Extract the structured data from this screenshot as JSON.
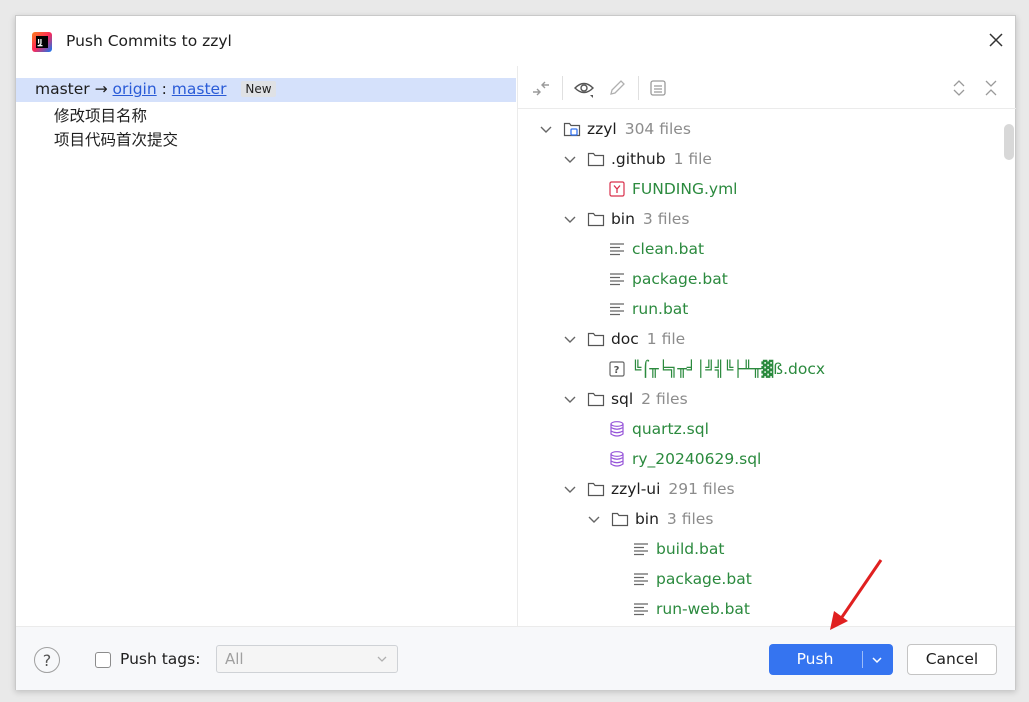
{
  "window": {
    "title": "Push Commits to zzyl"
  },
  "left_panel": {
    "branch": {
      "local": "master",
      "arrow": "→",
      "remote": "origin",
      "separator": ":",
      "remote_branch": "master",
      "badge": "New"
    },
    "commits": [
      "修改项目名称",
      "项目代码首次提交"
    ]
  },
  "toolbar": {
    "icons": [
      "diff-icon",
      "eye-icon",
      "edit-icon",
      "changelist-icon",
      "expand-all-icon",
      "collapse-all-icon"
    ]
  },
  "tree": [
    {
      "name": "zzyl",
      "count": "304 files",
      "type": "module",
      "level": 0,
      "expanded": true
    },
    {
      "name": ".github",
      "count": "1 file",
      "type": "folder",
      "level": 1,
      "expanded": true
    },
    {
      "name": "FUNDING.yml",
      "type": "yaml",
      "level": 2
    },
    {
      "name": "bin",
      "count": "3 files",
      "type": "folder",
      "level": 1,
      "expanded": true
    },
    {
      "name": "clean.bat",
      "type": "text",
      "level": 2
    },
    {
      "name": "package.bat",
      "type": "text",
      "level": 2
    },
    {
      "name": "run.bat",
      "type": "text",
      "level": 2
    },
    {
      "name": "doc",
      "count": "1 file",
      "type": "folder",
      "level": 1,
      "expanded": true
    },
    {
      "name": "╚⌠╥╘╗╥╛│╝╣╚├╨╥▓ß.docx",
      "type": "unknown",
      "level": 2
    },
    {
      "name": "sql",
      "count": "2 files",
      "type": "folder",
      "level": 1,
      "expanded": true
    },
    {
      "name": "quartz.sql",
      "type": "sql",
      "level": 2
    },
    {
      "name": "ry_20240629.sql",
      "type": "sql",
      "level": 2
    },
    {
      "name": "zzyl-ui",
      "count": "291 files",
      "type": "folder",
      "level": 1,
      "expanded": true
    },
    {
      "name": "bin",
      "count": "3 files",
      "type": "folder",
      "level": 2,
      "expanded": true
    },
    {
      "name": "build.bat",
      "type": "text",
      "level": 3
    },
    {
      "name": "package.bat",
      "type": "text",
      "level": 3
    },
    {
      "name": "run-web.bat",
      "type": "text",
      "level": 3
    }
  ],
  "footer": {
    "help": "?",
    "push_tags_label": "Push tags:",
    "push_tags_value": "All",
    "push_button": "Push",
    "cancel_button": "Cancel"
  },
  "colors": {
    "accent": "#3574f0",
    "selection": "#d5e1fb",
    "added_file": "#2b8a3e",
    "link": "#2a5bd7",
    "annotation_arrow": "#e02020"
  }
}
